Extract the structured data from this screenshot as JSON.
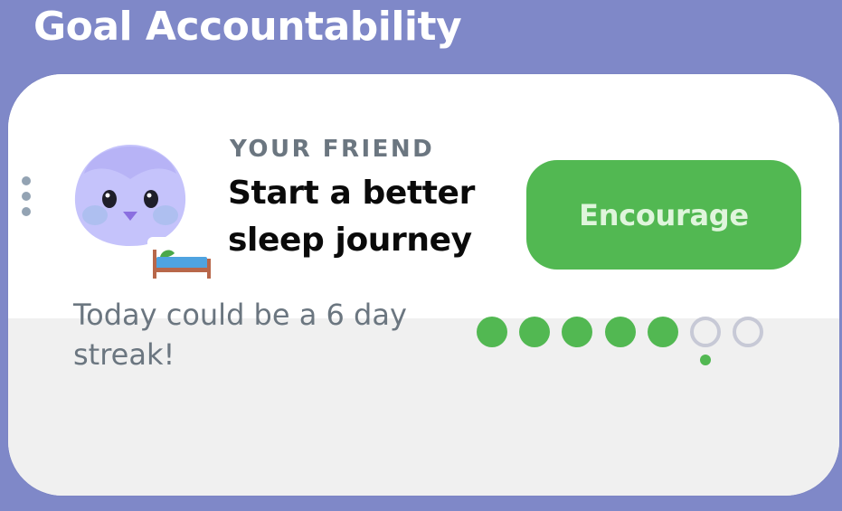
{
  "header": {
    "title": "Goal Accountability"
  },
  "card": {
    "eyebrow": "YOUR FRIEND",
    "goal_title": "Start a better sleep journey",
    "encourage_label": "Encourage",
    "goal_icon": "bed-icon",
    "avatar_icon": "owl-avatar",
    "menu_icon": "more-vertical-icon"
  },
  "streak": {
    "message": "Today could be a 6 day streak!",
    "total_days": 7,
    "completed_days": 5,
    "current_day_index": 5,
    "colors": {
      "filled": "#52b852",
      "empty": "#c7c9d6"
    }
  },
  "colors": {
    "background": "#7f88c8",
    "accent": "#52b852",
    "button_text": "#dff5dc",
    "muted_text": "#6b7680"
  }
}
